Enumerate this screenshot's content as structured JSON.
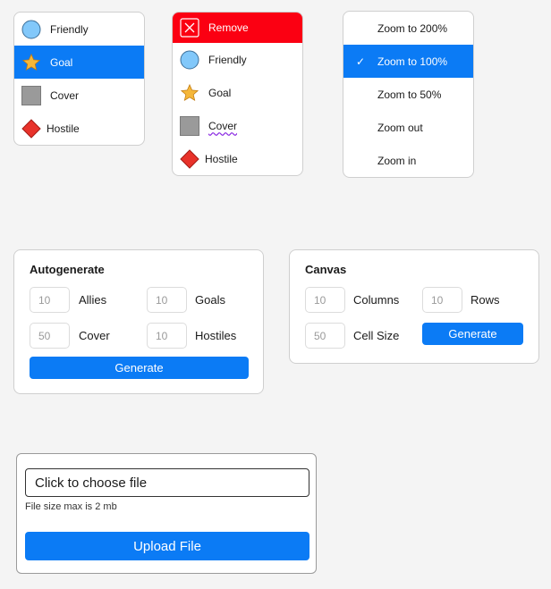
{
  "menu_markers": {
    "items": [
      {
        "label": "Friendly",
        "icon": "circle-icon"
      },
      {
        "label": "Goal",
        "icon": "star-icon",
        "selected": true
      },
      {
        "label": "Cover",
        "icon": "square-icon"
      },
      {
        "label": "Hostile",
        "icon": "diamond-icon"
      }
    ]
  },
  "menu_context": {
    "items": [
      {
        "label": "Remove",
        "icon": "remove-icon"
      },
      {
        "label": "Friendly",
        "icon": "circle-icon"
      },
      {
        "label": "Goal",
        "icon": "star-icon"
      },
      {
        "label": "Cover",
        "icon": "square-icon"
      },
      {
        "label": "Hostile",
        "icon": "diamond-icon"
      }
    ]
  },
  "menu_zoom": {
    "check_mark": "✓",
    "items": [
      {
        "label": "Zoom to 200%"
      },
      {
        "label": "Zoom to 100%",
        "selected": true
      },
      {
        "label": "Zoom to 50%"
      },
      {
        "label": "Zoom out"
      },
      {
        "label": "Zoom in"
      }
    ]
  },
  "autogenerate": {
    "title": "Autogenerate",
    "allies": {
      "value": "10",
      "label": "Allies"
    },
    "goals": {
      "value": "10",
      "label": "Goals"
    },
    "cover": {
      "value": "50",
      "label": "Cover"
    },
    "hostiles": {
      "value": "10",
      "label": "Hostiles"
    },
    "button": "Generate"
  },
  "canvas": {
    "title": "Canvas",
    "columns": {
      "value": "10",
      "label": "Columns"
    },
    "rows": {
      "value": "10",
      "label": "Rows"
    },
    "cell_size": {
      "value": "50",
      "label": "Cell Size"
    },
    "button": "Generate"
  },
  "upload": {
    "placeholder": "Click to choose file",
    "hint": "File size max is 2 mb",
    "button": "Upload File"
  },
  "colors": {
    "accent": "#0b7bf5",
    "danger": "#fb0012",
    "friendly": "#82c8fa",
    "goal": "#f5b73a",
    "cover": "#9a9a9a",
    "hostile": "#e8322a"
  }
}
